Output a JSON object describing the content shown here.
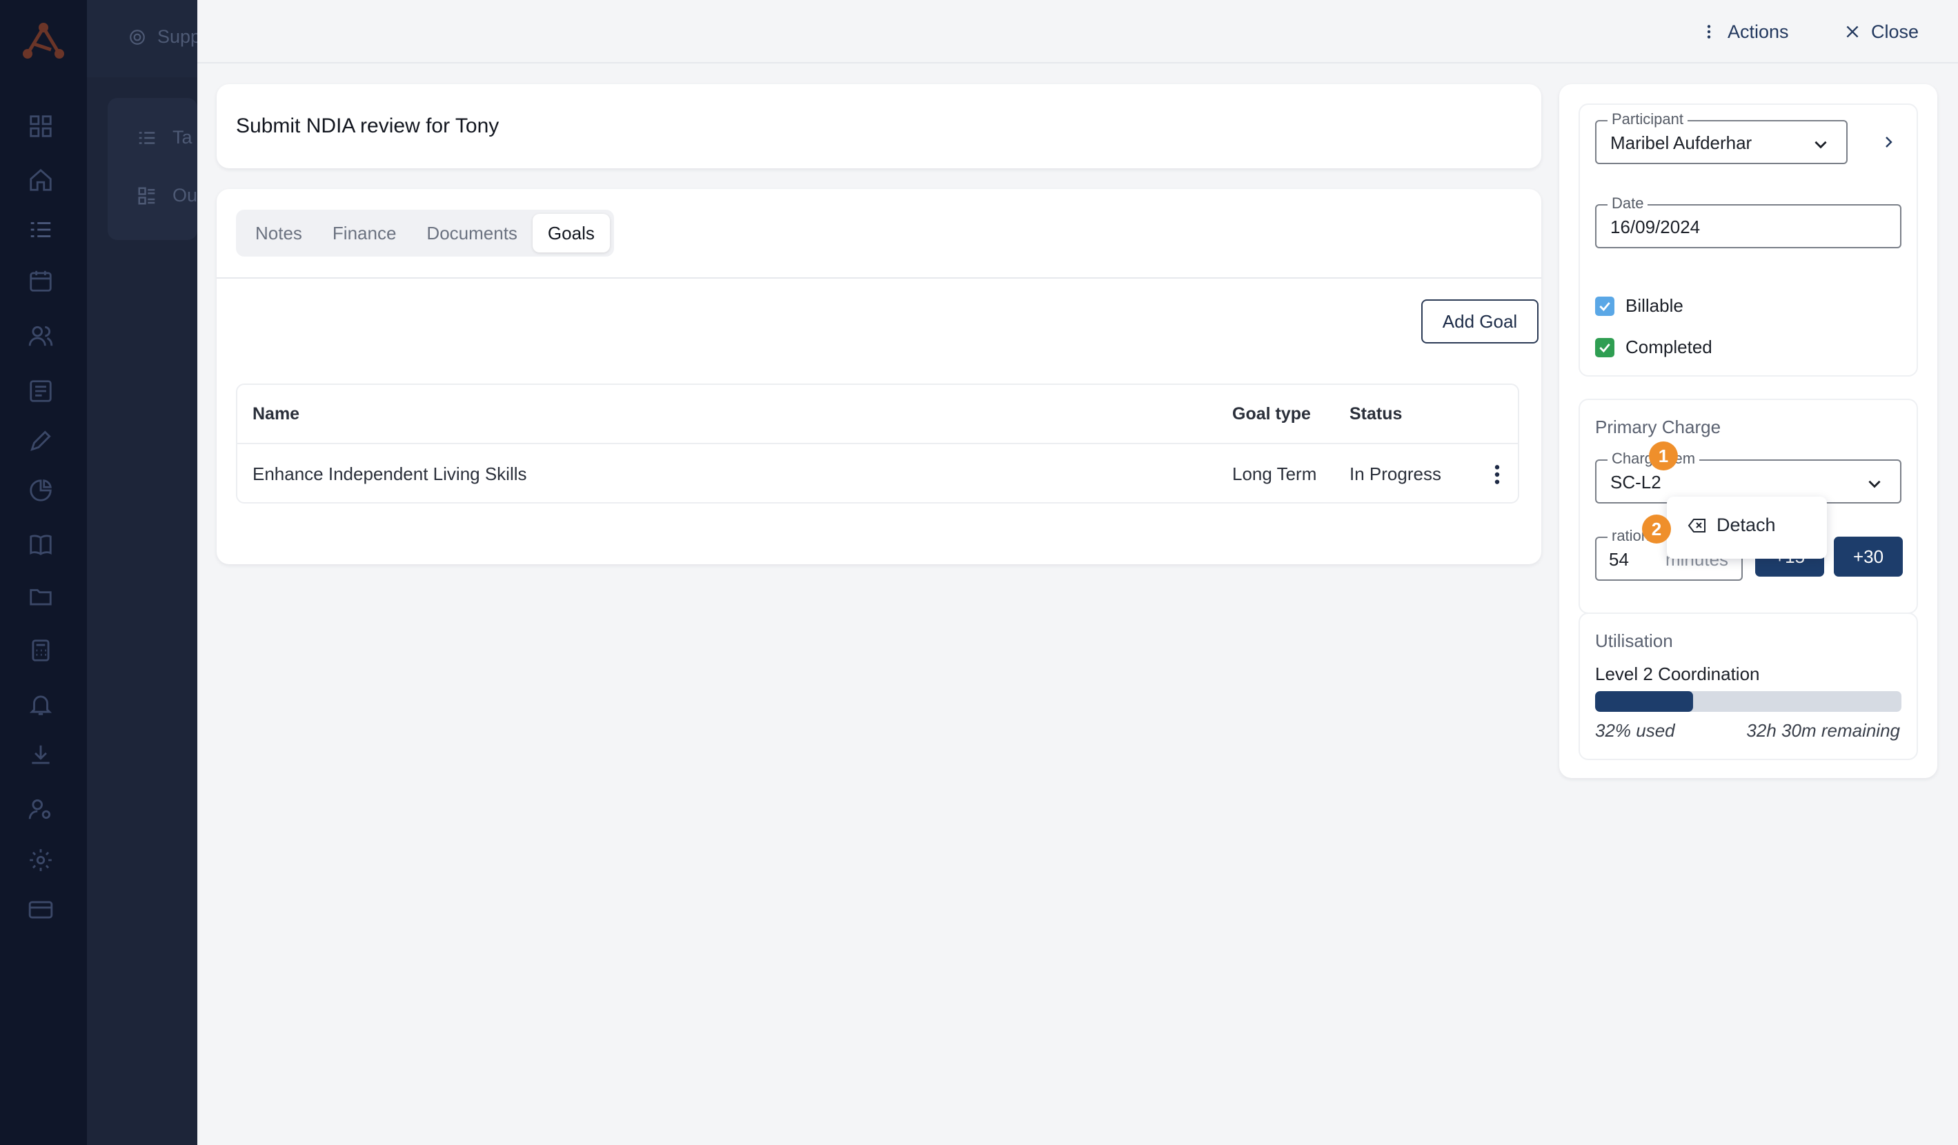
{
  "background": {
    "crumb_label": "Supp",
    "menu_items": [
      "Ta",
      "Ou"
    ]
  },
  "header": {
    "actions_label": "Actions",
    "close_label": "Close"
  },
  "task": {
    "title": "Submit NDIA review for Tony"
  },
  "tabs": [
    {
      "label": "Notes",
      "active": false
    },
    {
      "label": "Finance",
      "active": false
    },
    {
      "label": "Documents",
      "active": false
    },
    {
      "label": "Goals",
      "active": true
    }
  ],
  "goals": {
    "add_label": "Add Goal",
    "columns": {
      "name": "Name",
      "type": "Goal type",
      "status": "Status"
    },
    "rows": [
      {
        "name": "Enhance Independent Living Skills",
        "type": "Long Term",
        "status": "In Progress"
      }
    ],
    "menu": {
      "detach_label": "Detach"
    }
  },
  "badges": {
    "one": "1",
    "two": "2"
  },
  "side": {
    "participant": {
      "label": "Participant",
      "value": "Maribel Aufderhar"
    },
    "date": {
      "label": "Date",
      "value": "16/09/2024"
    },
    "billable": {
      "label": "Billable",
      "checked": true,
      "color": "#5aa7e6"
    },
    "completed": {
      "label": "Completed",
      "checked": true,
      "color": "#2f9e52"
    },
    "primary_charge": {
      "title": "Primary Charge",
      "charge_item_label": "Charge Item",
      "charge_item_value": "SC-L2",
      "duration_label": "ration",
      "duration_value": "54",
      "duration_unit": "minutes",
      "plus15": "+15",
      "plus30": "+30"
    },
    "utilisation": {
      "title": "Utilisation",
      "item": "Level 2 Coordination",
      "percent_used": 32,
      "used_text": "32% used",
      "remaining_text": "32h 30m remaining"
    }
  },
  "colors": {
    "accent": "#1d3d6b",
    "badge": "#ef8f2b"
  }
}
